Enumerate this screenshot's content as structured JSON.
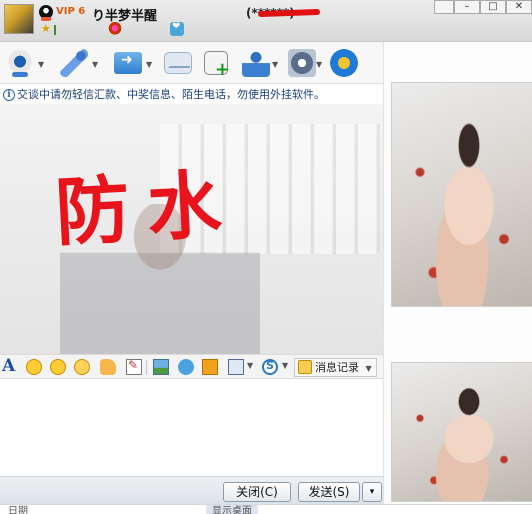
{
  "titlebar": {
    "vip_label": "VIP 6",
    "nickname": "り半梦半醒",
    "qq_number": "(******)"
  },
  "window_controls": {
    "min": "–",
    "max": "□",
    "close": "✕"
  },
  "toolbar": {
    "icons": [
      "video-camera-icon",
      "microphone-icon",
      "send-file-icon",
      "mail-icon",
      "add-note-icon",
      "profile-icon",
      "settings-icon",
      "browser-icon"
    ]
  },
  "notice": {
    "text": "交谈中请勿轻信汇款、中奖信息、陌生电话，勿使用外挂软件。"
  },
  "chat": {
    "scribble_text": "防水"
  },
  "format_bar": {
    "font_label": "A",
    "message_log_label": "消息记录"
  },
  "buttons": {
    "close_label": "关闭(C)",
    "send_label": "发送(S)",
    "send_more_label": "▾"
  },
  "taskbar": {
    "left_text": "日期",
    "mid_text": "显示桌面"
  },
  "colors": {
    "scribble": "#e8131b",
    "notice_text": "#1a3e7a",
    "redaction": "#e01010"
  }
}
